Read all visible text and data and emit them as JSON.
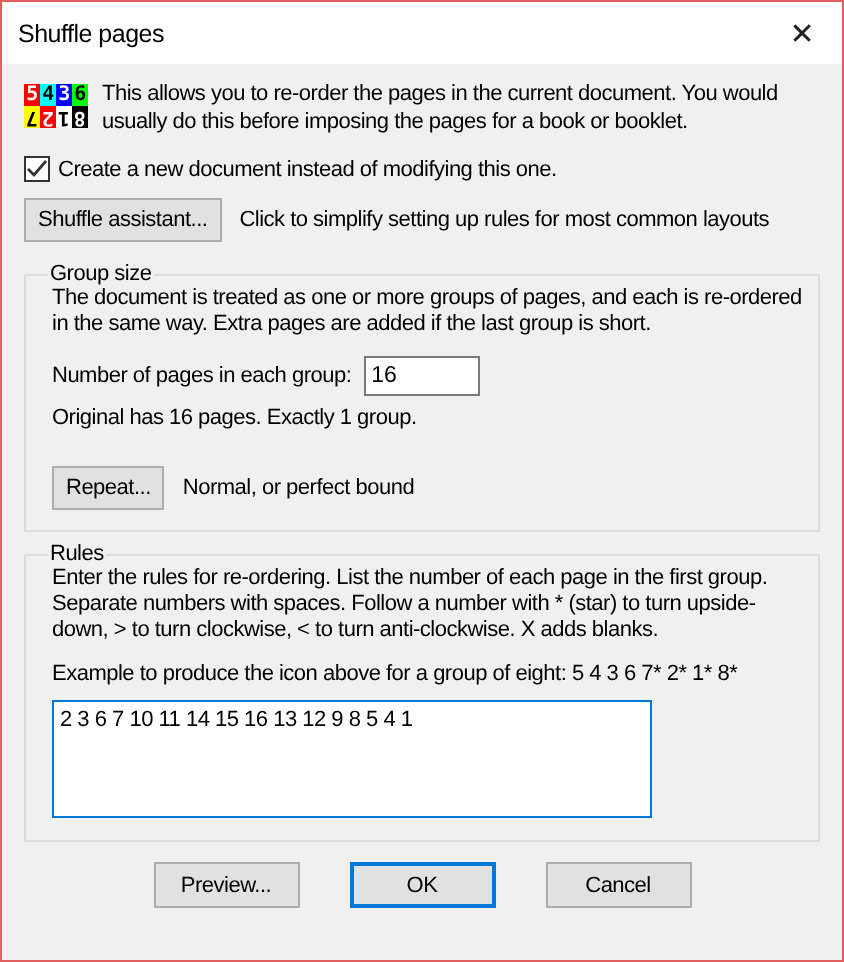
{
  "window": {
    "title": "Shuffle pages",
    "close": "✕"
  },
  "icon_cells": [
    {
      "label": "5",
      "color": "#ff0000",
      "upside_down": false
    },
    {
      "label": "4",
      "color": "#00ffff",
      "upside_down": false
    },
    {
      "label": "3",
      "color": "#0000ff",
      "upside_down": false
    },
    {
      "label": "6",
      "color": "#00ff00",
      "upside_down": false
    },
    {
      "label": "7",
      "color": "#ffff00",
      "upside_down": true
    },
    {
      "label": "2",
      "color": "#ff0000",
      "upside_down": true
    },
    {
      "label": "1",
      "color": "#ffffff",
      "upside_down": true
    },
    {
      "label": "8",
      "color": "#000000",
      "upside_down": true
    }
  ],
  "intro": "This allows you to re-order the pages in the current document. You would usually do this before imposing the pages for a book or booklet.",
  "new_document": {
    "label": "Create a new document instead of modifying this one.",
    "checked": true
  },
  "assistant": {
    "button": "Shuffle assistant...",
    "hint": "Click to simplify setting up rules for most common layouts"
  },
  "group_size": {
    "title": "Group size",
    "description": "The document is treated as one or more groups of pages, and each is re-ordered in the same way. Extra pages are added if the last group is short.",
    "field_label": "Number of pages in each group:",
    "value": "16",
    "info": "Original has 16 pages. Exactly 1 group.",
    "repeat_button": "Repeat...",
    "repeat_mode": "Normal, or perfect bound"
  },
  "rules": {
    "title": "Rules",
    "description": "Enter the rules for re-ordering. List the number of each page in the first group. Separate numbers with spaces. Follow a number with * (star)  to turn upside-down, > to turn clockwise, < to turn anti-clockwise. X adds blanks.",
    "example": "Example to produce the icon above for a group of eight: 5 4 3 6 7* 2* 1* 8*",
    "value": "2 3 6 7 10 11 14 15 16 13 12 9 8 5 4 1"
  },
  "buttons": [
    {
      "label": "Preview...",
      "default": false
    },
    {
      "label": "OK",
      "default": true
    },
    {
      "label": "Cancel",
      "default": false
    }
  ]
}
